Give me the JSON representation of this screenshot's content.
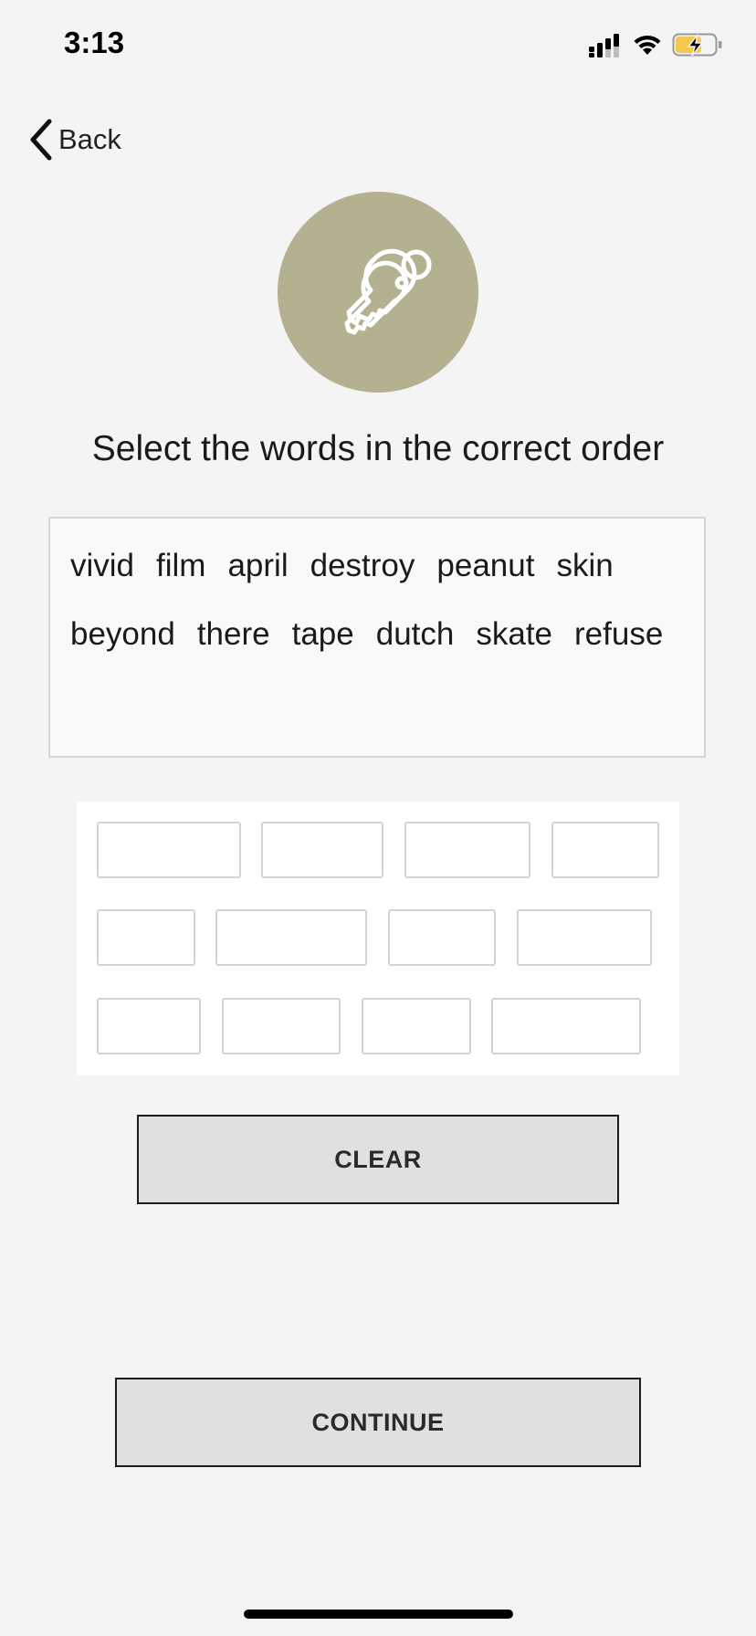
{
  "status_bar": {
    "time": "3:13",
    "battery_color": "#f2c94c"
  },
  "nav": {
    "back_label": "Back"
  },
  "hero": {
    "icon": "keys-icon",
    "circle_color": "#b3b190"
  },
  "instruction": "Select the words in the correct order",
  "word_bank": {
    "words": [
      "vivid",
      "film",
      "april",
      "destroy",
      "peanut",
      "skin",
      "beyond",
      "there",
      "tape",
      "dutch",
      "skate",
      "refuse"
    ]
  },
  "answer_slots": {
    "count": 12,
    "filled": []
  },
  "buttons": {
    "clear": "CLEAR",
    "continue": "CONTINUE"
  }
}
